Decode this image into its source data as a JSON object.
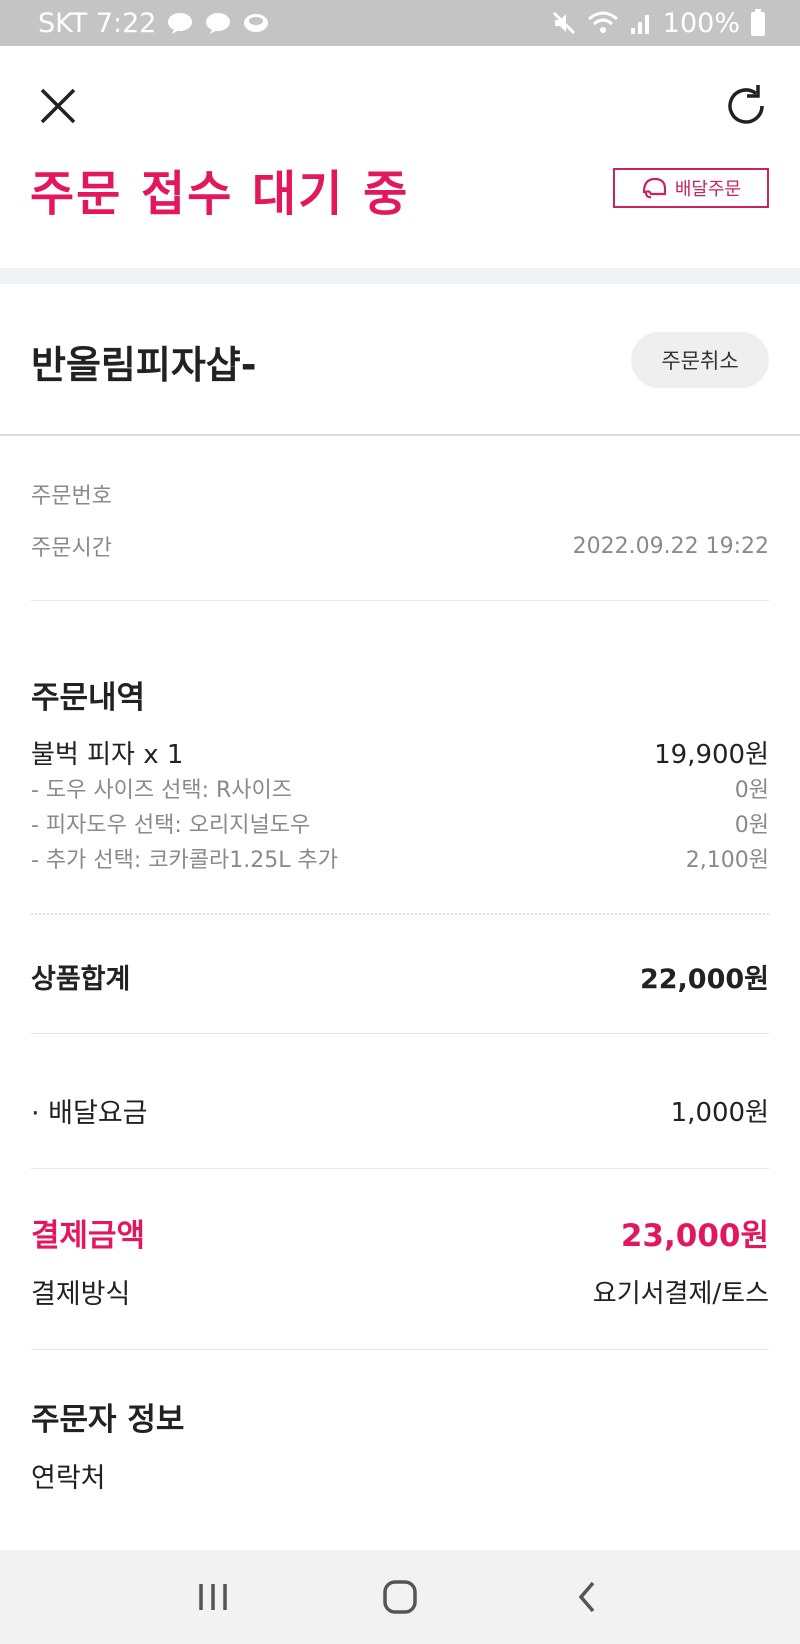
{
  "status_bar": {
    "carrier_time": "SKT 7:22",
    "battery": "100%"
  },
  "header": {
    "title": "주문 접수 대기 중",
    "delivery_badge": "배달주문"
  },
  "store": {
    "name": "반올림피자샵-",
    "cancel_label": "주문취소"
  },
  "order_meta": {
    "order_number_label": "주문번호",
    "order_time_label": "주문시간",
    "order_time_value": "2022.09.22 19:22"
  },
  "order_details": {
    "title": "주문내역",
    "item": {
      "name": "불벅  피자 x 1",
      "price": "19,900원"
    },
    "options": [
      {
        "label": "- 도우 사이즈 선택: R사이즈",
        "price": "0원"
      },
      {
        "label": "- 피자도우 선택: 오리지널도우",
        "price": "0원"
      },
      {
        "label": "- 추가 선택: 코카콜라1.25L 추가",
        "price": "2,100원"
      }
    ]
  },
  "subtotal": {
    "label": "상품합계",
    "value": "22,000원"
  },
  "delivery_fee": {
    "label": "· 배달요금",
    "value": "1,000원"
  },
  "payment": {
    "total_label": "결제금액",
    "total_value": "23,000원",
    "method_label": "결제방식",
    "method_value": "요기서결제/토스"
  },
  "orderer": {
    "title": "주문자 정보",
    "contact_label": "연락처"
  },
  "colors": {
    "accent": "#e3185c",
    "status_bar": "#c4c4c4"
  },
  "icons": {
    "close": "close-icon",
    "refresh": "refresh-icon",
    "helmet": "helmet-icon",
    "nav_recent": "recent-apps-icon",
    "nav_home": "home-icon",
    "nav_back": "back-icon"
  }
}
